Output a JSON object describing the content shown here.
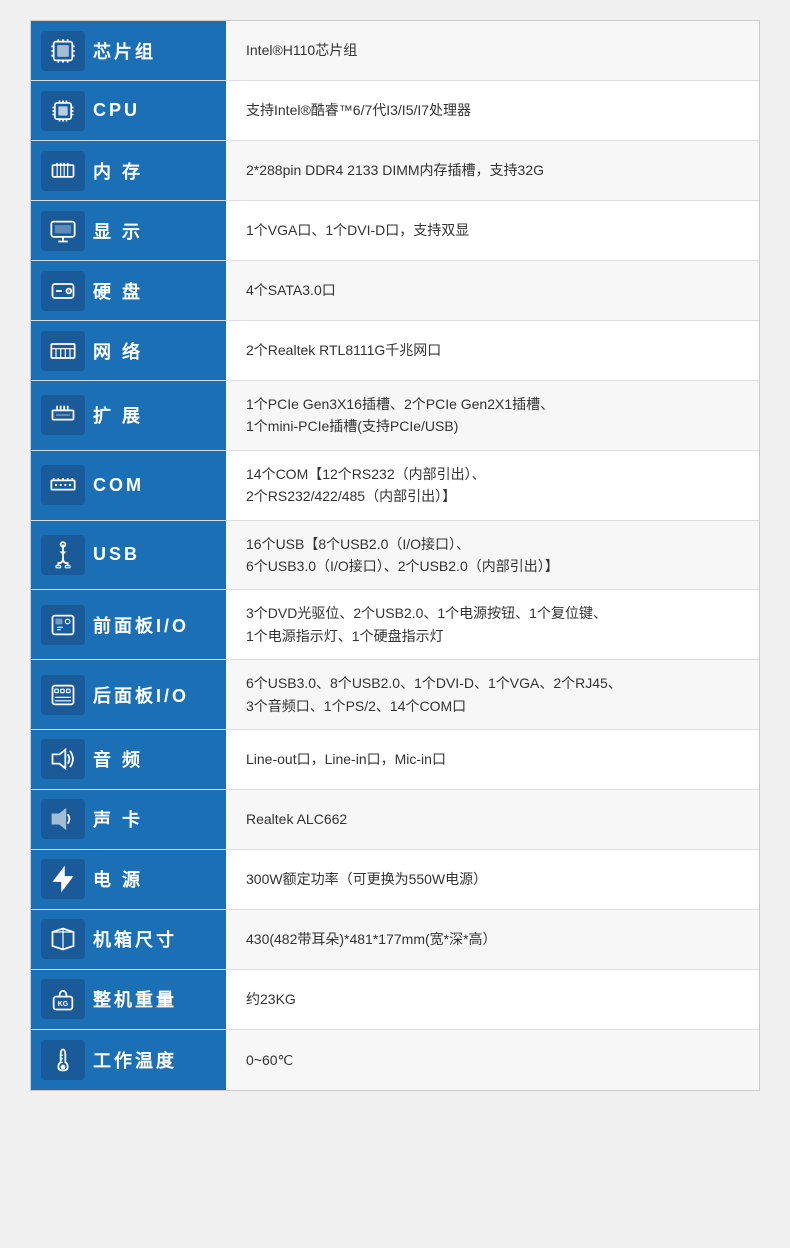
{
  "rows": [
    {
      "id": "chipset",
      "icon": "chipset",
      "label": "芯片组",
      "value": "Intel®H110芯片组"
    },
    {
      "id": "cpu",
      "icon": "cpu",
      "label": "CPU",
      "value": "支持Intel®酷睿™6/7代I3/I5/I7处理器"
    },
    {
      "id": "memory",
      "icon": "memory",
      "label": "内  存",
      "value": "2*288pin DDR4 2133 DIMM内存插槽，支持32G"
    },
    {
      "id": "display",
      "icon": "display",
      "label": "显  示",
      "value": "1个VGA口、1个DVI-D口，支持双显"
    },
    {
      "id": "harddisk",
      "icon": "harddisk",
      "label": "硬  盘",
      "value": "4个SATA3.0口"
    },
    {
      "id": "network",
      "icon": "network",
      "label": "网  络",
      "value": "2个Realtek RTL8111G千兆网口"
    },
    {
      "id": "expansion",
      "icon": "expansion",
      "label": "扩  展",
      "value": "1个PCIe Gen3X16插槽、2个PCIe Gen2X1插槽、\n1个mini-PCIe插槽(支持PCIe/USB)"
    },
    {
      "id": "com",
      "icon": "com",
      "label": "COM",
      "value": "14个COM【12个RS232（内部引出）、\n2个RS232/422/485（内部引出）】"
    },
    {
      "id": "usb",
      "icon": "usb",
      "label": "USB",
      "value": "16个USB【8个USB2.0（I/O接口）、\n6个USB3.0（I/O接口）、2个USB2.0（内部引出）】"
    },
    {
      "id": "front-panel",
      "icon": "front-panel",
      "label": "前面板I/O",
      "value": "3个DVD光驱位、2个USB2.0、1个电源按钮、1个复位键、\n1个电源指示灯、1个硬盘指示灯"
    },
    {
      "id": "rear-panel",
      "icon": "rear-panel",
      "label": "后面板I/O",
      "value": "6个USB3.0、8个USB2.0、1个DVI-D、1个VGA、2个RJ45、\n3个音频口、1个PS/2、14个COM口"
    },
    {
      "id": "audio",
      "icon": "audio",
      "label": "音  频",
      "value": "Line-out口，Line-in口，Mic-in口"
    },
    {
      "id": "sound-card",
      "icon": "sound-card",
      "label": "声  卡",
      "value": "Realtek ALC662"
    },
    {
      "id": "power",
      "icon": "power",
      "label": "电  源",
      "value": "300W额定功率（可更换为550W电源）"
    },
    {
      "id": "case-size",
      "icon": "case-size",
      "label": "机箱尺寸",
      "value": "430(482带耳朵)*481*177mm(宽*深*高）"
    },
    {
      "id": "weight",
      "icon": "weight",
      "label": "整机重量",
      "value": "约23KG"
    },
    {
      "id": "temp",
      "icon": "temp",
      "label": "工作温度",
      "value": "0~60℃"
    }
  ]
}
